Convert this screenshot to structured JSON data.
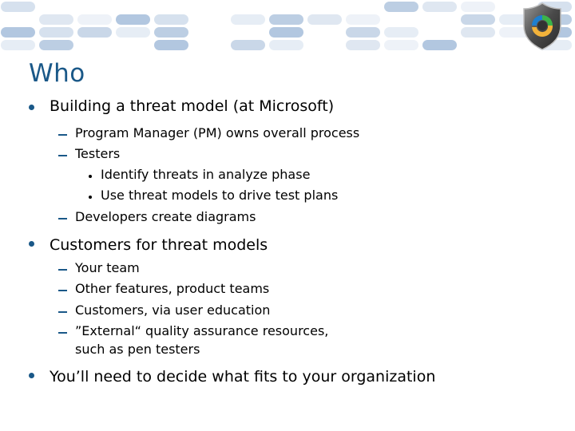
{
  "slide": {
    "title": "Who",
    "logo_icon": "shield-with-circular-arrows-icon",
    "accent_color": "#1a5888",
    "bullets": [
      {
        "text": "Building a threat model (at Microsoft)",
        "sub": [
          {
            "text": "Program Manager (PM) owns overall process"
          },
          {
            "text": "Testers",
            "sub": [
              {
                "text": "Identify threats in analyze phase"
              },
              {
                "text": "Use threat models to drive test plans"
              }
            ]
          },
          {
            "text": "Developers create diagrams"
          }
        ]
      },
      {
        "text": "Customers for threat models",
        "sub": [
          {
            "text": "Your team"
          },
          {
            "text": "Other features, product teams"
          },
          {
            "text": "Customers, via user education"
          },
          {
            "text": "”External“ quality assurance resources,",
            "continuation": "such as pen testers"
          }
        ]
      },
      {
        "text": "You’ll need to decide what fits to your organization"
      }
    ]
  }
}
